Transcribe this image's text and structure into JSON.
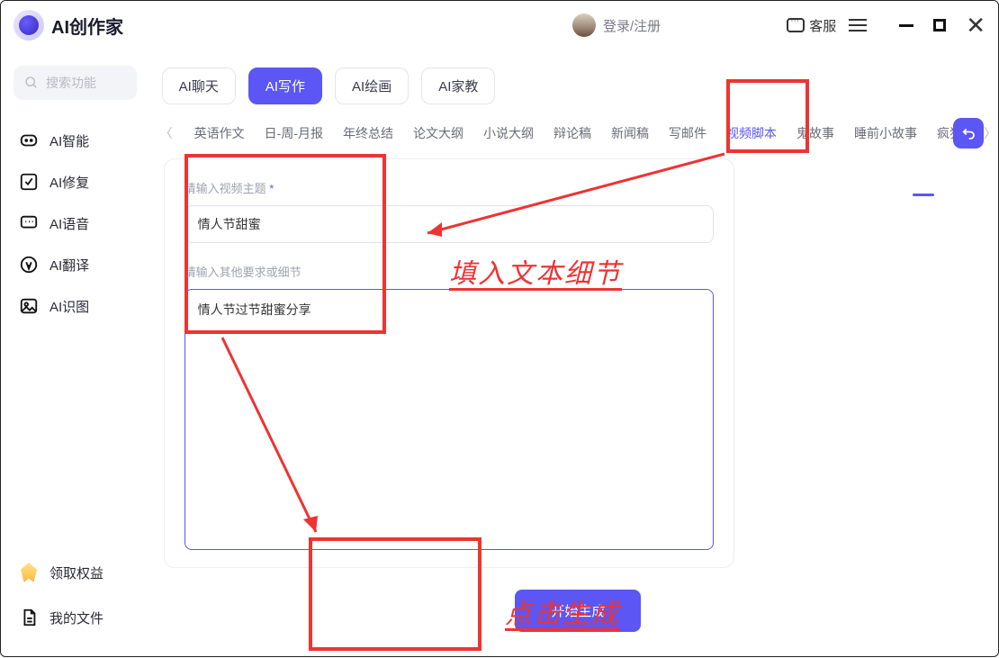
{
  "app": {
    "title": "AI创作家"
  },
  "header": {
    "login_text": "登录/注册",
    "support_label": "客服"
  },
  "sidebar": {
    "search_placeholder": "搜索功能",
    "items": [
      {
        "label": "AI智能"
      },
      {
        "label": "AI修复"
      },
      {
        "label": "AI语音"
      },
      {
        "label": "AI翻译"
      },
      {
        "label": "AI识图"
      }
    ],
    "footer": [
      {
        "label": "领取权益"
      },
      {
        "label": "我的文件"
      }
    ]
  },
  "tabs": [
    "AI聊天",
    "AI写作",
    "AI绘画",
    "AI家教"
  ],
  "active_tab": "AI写作",
  "categories": [
    "英语作文",
    "日-周-月报",
    "年终总结",
    "论文大纲",
    "小说大纲",
    "辩论稿",
    "新闻稿",
    "写邮件",
    "视频脚本",
    "鬼故事",
    "睡前小故事",
    "疯狂"
  ],
  "active_category": "视频脚本",
  "form": {
    "topic_label": "请输入视频主题",
    "topic_value": "情人节甜蜜",
    "extra_label": "请输入其他要求或细节",
    "extra_value": "情人节过节甜蜜分享",
    "generate_label": "开始生成"
  },
  "annotations": {
    "fill_text": "填入文本细节",
    "click_gen": "点击生成"
  }
}
